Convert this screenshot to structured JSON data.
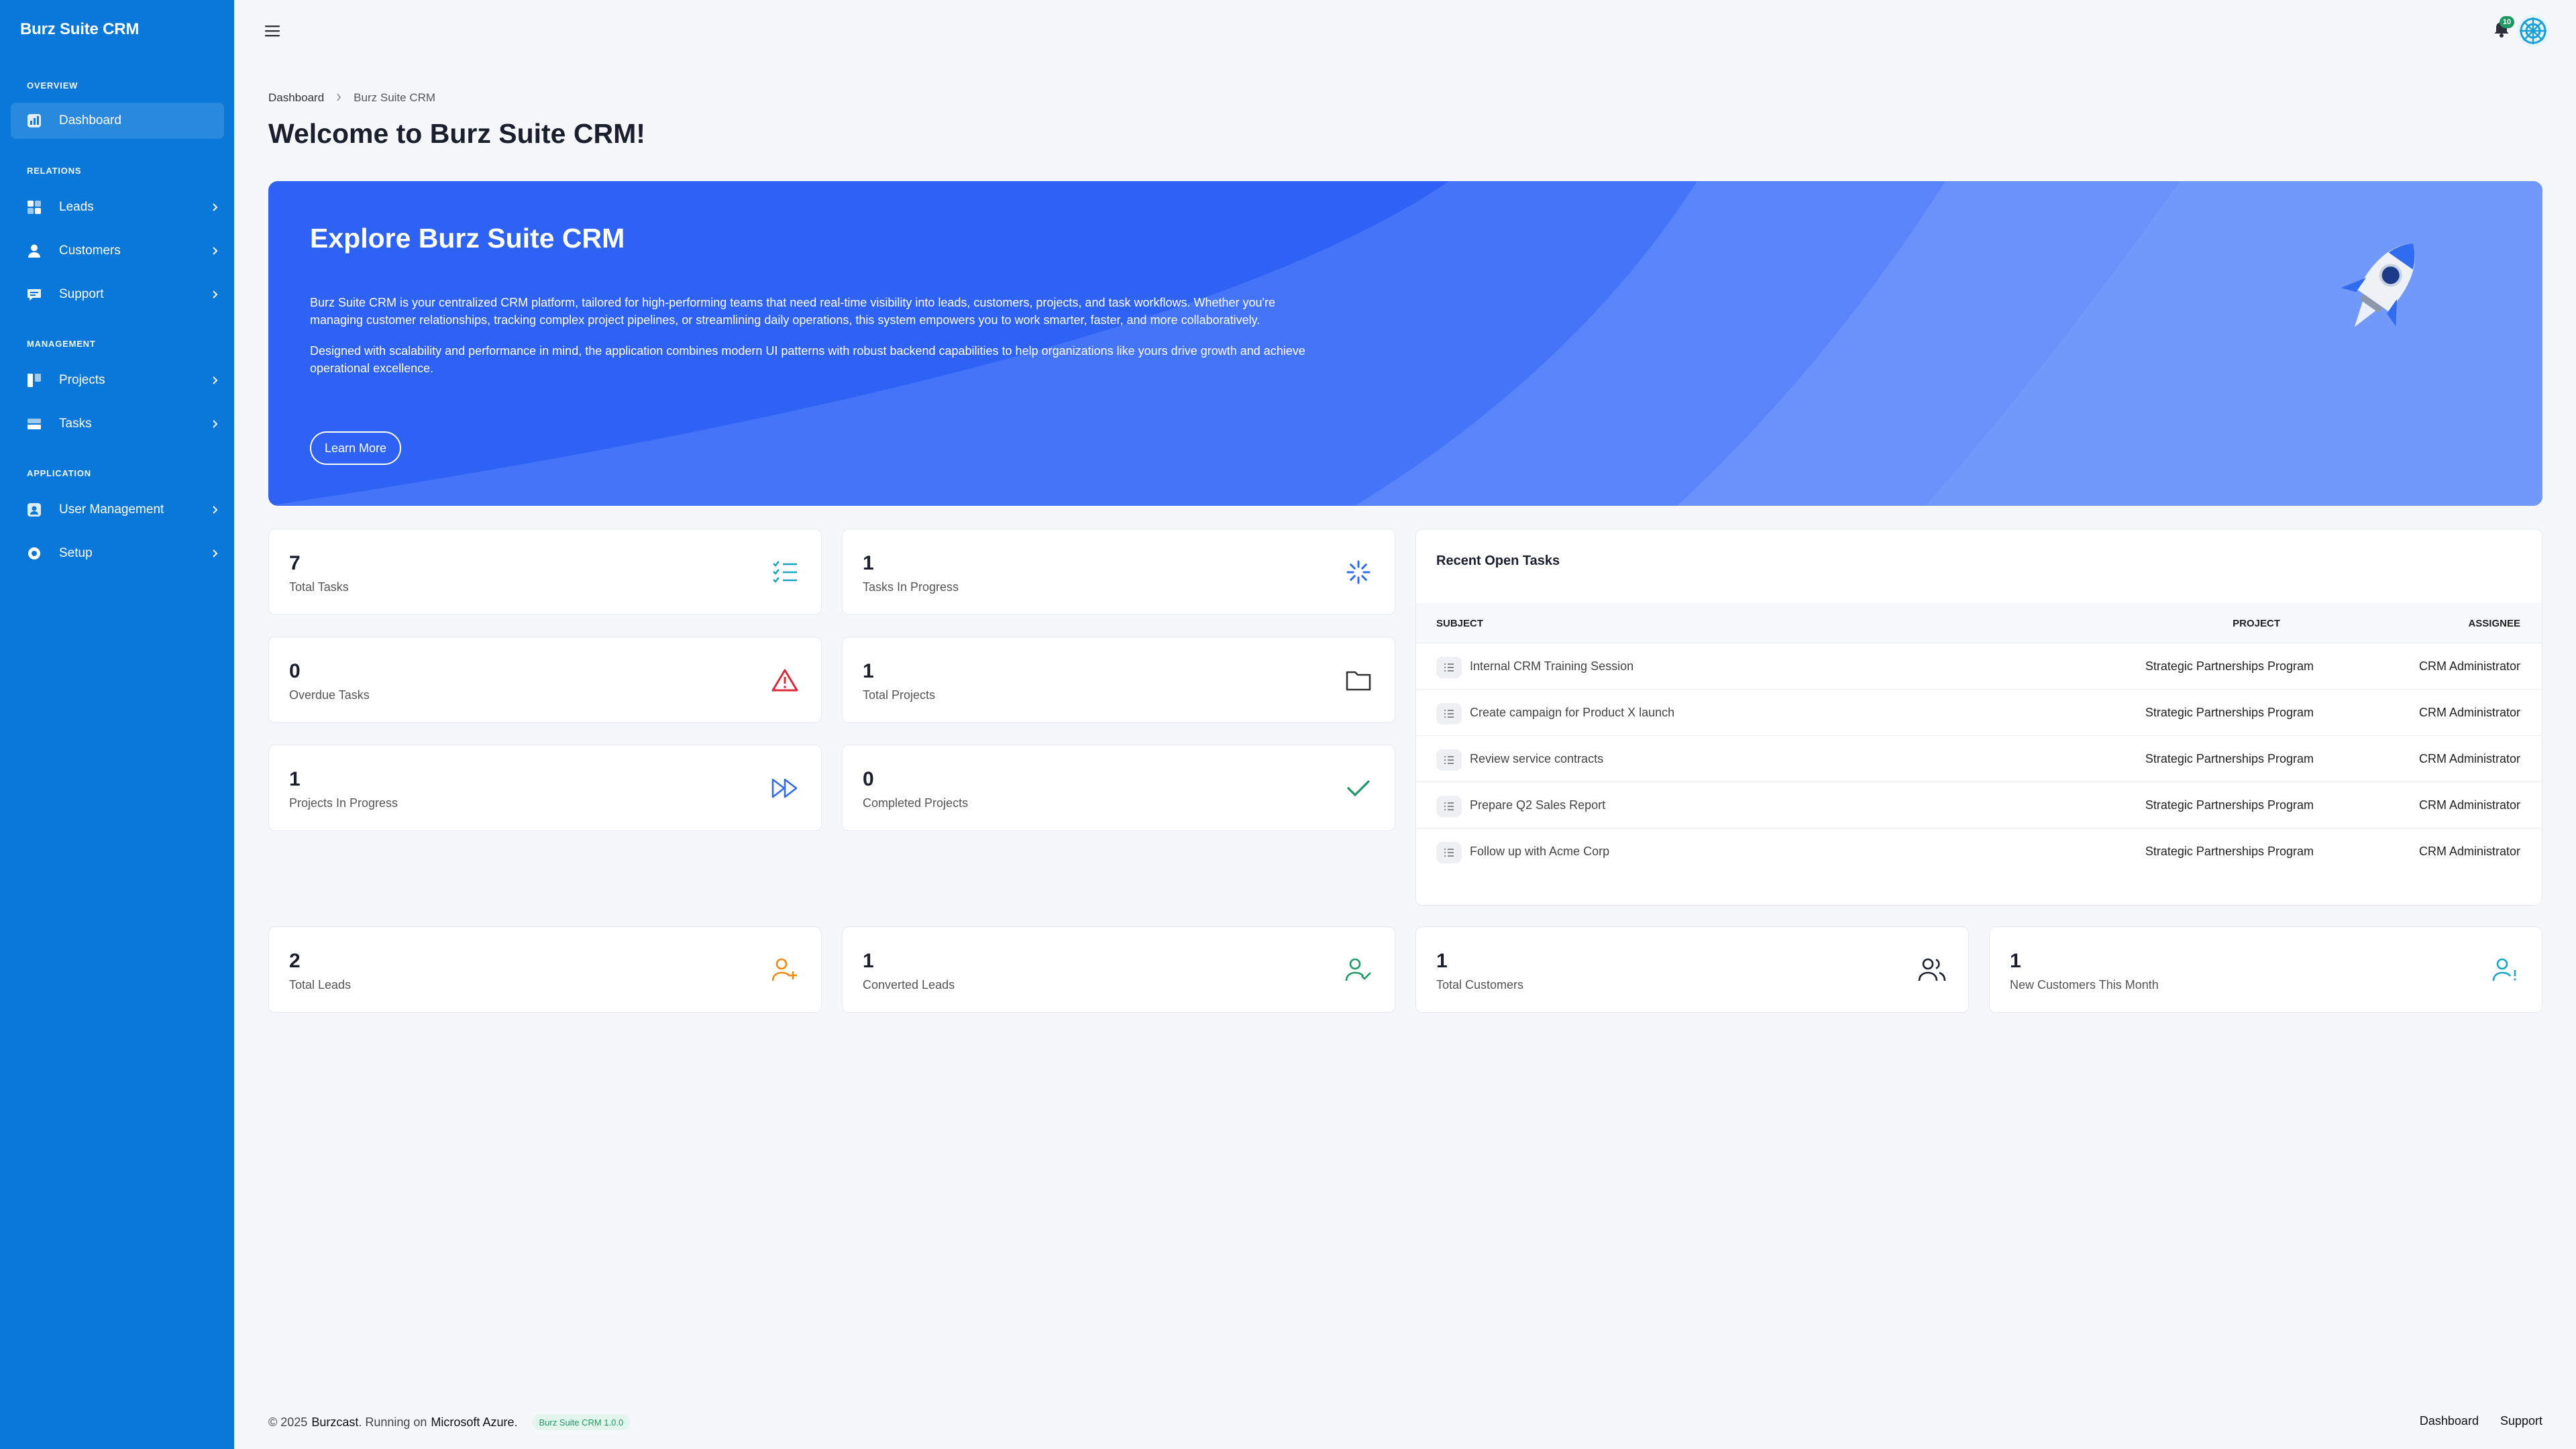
{
  "app": {
    "title": "Burz Suite CRM"
  },
  "sidebar": {
    "sections": {
      "overview": "OVERVIEW",
      "relations": "RELATIONS",
      "management": "MANAGEMENT",
      "application": "APPLICATION"
    },
    "items": {
      "dashboard": {
        "label": "Dashboard",
        "icon": "dashboard-icon"
      },
      "leads": {
        "label": "Leads",
        "icon": "leads-icon"
      },
      "customers": {
        "label": "Customers",
        "icon": "user-icon"
      },
      "support": {
        "label": "Support",
        "icon": "chat-icon"
      },
      "projects": {
        "label": "Projects",
        "icon": "projects-icon"
      },
      "tasks": {
        "label": "Tasks",
        "icon": "tasks-icon"
      },
      "user_management": {
        "label": "User Management",
        "icon": "user-badge-icon"
      },
      "setup": {
        "label": "Setup",
        "icon": "setup-icon"
      }
    }
  },
  "topbar": {
    "notification_count": "10"
  },
  "breadcrumb": {
    "root": "Dashboard",
    "current": "Burz Suite CRM"
  },
  "page": {
    "title": "Welcome to Burz Suite CRM!"
  },
  "hero": {
    "title": "Explore Burz Suite CRM",
    "para1_line1": "Burz Suite CRM is your centralized CRM platform, tailored for high-performing teams that need real-time visibility into leads, customers, projects, and task workflows. Whether you're",
    "para1_line2": "managing customer relationships, tracking complex project pipelines, or streamlining daily operations, this system empowers you to work smarter, faster, and more collaboratively.",
    "para2_line1": "Designed with scalability and performance in mind, the application combines modern UI patterns with robust backend capabilities to help organizations like yours drive growth and achieve",
    "para2_line2": "operational excellence.",
    "button": "Learn More"
  },
  "stats": {
    "total_tasks": {
      "value": "7",
      "label": "Total Tasks",
      "icon": "checklist-icon",
      "color": "#17a6c4"
    },
    "tasks_in_progress": {
      "value": "1",
      "label": "Tasks In Progress",
      "icon": "spinner-icon",
      "color": "#2f6cf0"
    },
    "overdue_tasks": {
      "value": "0",
      "label": "Overdue Tasks",
      "icon": "warning-icon",
      "color": "#dc2a3a"
    },
    "total_projects": {
      "value": "1",
      "label": "Total Projects",
      "icon": "folder-icon",
      "color": "#333333"
    },
    "projects_in_progress": {
      "value": "1",
      "label": "Projects In Progress",
      "icon": "fast-forward-icon",
      "color": "#2f6cf0"
    },
    "completed_projects": {
      "value": "0",
      "label": "Completed Projects",
      "icon": "check-icon",
      "color": "#1d9a63"
    },
    "total_leads": {
      "value": "2",
      "label": "Total Leads",
      "icon": "user-plus-icon",
      "color": "#f08a0c"
    },
    "converted_leads": {
      "value": "1",
      "label": "Converted Leads",
      "icon": "user-check-icon",
      "color": "#1d9a63"
    },
    "total_customers": {
      "value": "1",
      "label": "Total Customers",
      "icon": "users-icon",
      "color": "#1a1f2e"
    },
    "new_customers": {
      "value": "1",
      "label": "New Customers This Month",
      "icon": "user-exclaim-icon",
      "color": "#17a6c4"
    }
  },
  "recent_tasks": {
    "title": "Recent Open Tasks",
    "columns": {
      "subject": "SUBJECT",
      "project": "PROJECT",
      "assignee": "ASSIGNEE"
    },
    "rows": [
      {
        "subject": "Internal CRM Training Session",
        "project": "Strategic Partnerships Program",
        "assignee": "CRM Administrator"
      },
      {
        "subject": "Create campaign for Product X launch",
        "project": "Strategic Partnerships Program",
        "assignee": "CRM Administrator"
      },
      {
        "subject": "Review service contracts",
        "project": "Strategic Partnerships Program",
        "assignee": "CRM Administrator"
      },
      {
        "subject": "Prepare Q2 Sales Report",
        "project": "Strategic Partnerships Program",
        "assignee": "CRM Administrator"
      },
      {
        "subject": "Follow up with Acme Corp",
        "project": "Strategic Partnerships Program",
        "assignee": "CRM Administrator"
      }
    ]
  },
  "footer": {
    "copyright": "© 2025",
    "company": "Burzcast",
    "running_on": ". Running on",
    "platform": "Microsoft Azure",
    "period": ".",
    "version": "Burz Suite CRM 1.0.0",
    "links": {
      "dashboard": "Dashboard",
      "support": "Support"
    }
  },
  "colors": {
    "sidebar": "#0a78d8",
    "hero": "#2e62f5",
    "background": "#f5f7fa"
  }
}
